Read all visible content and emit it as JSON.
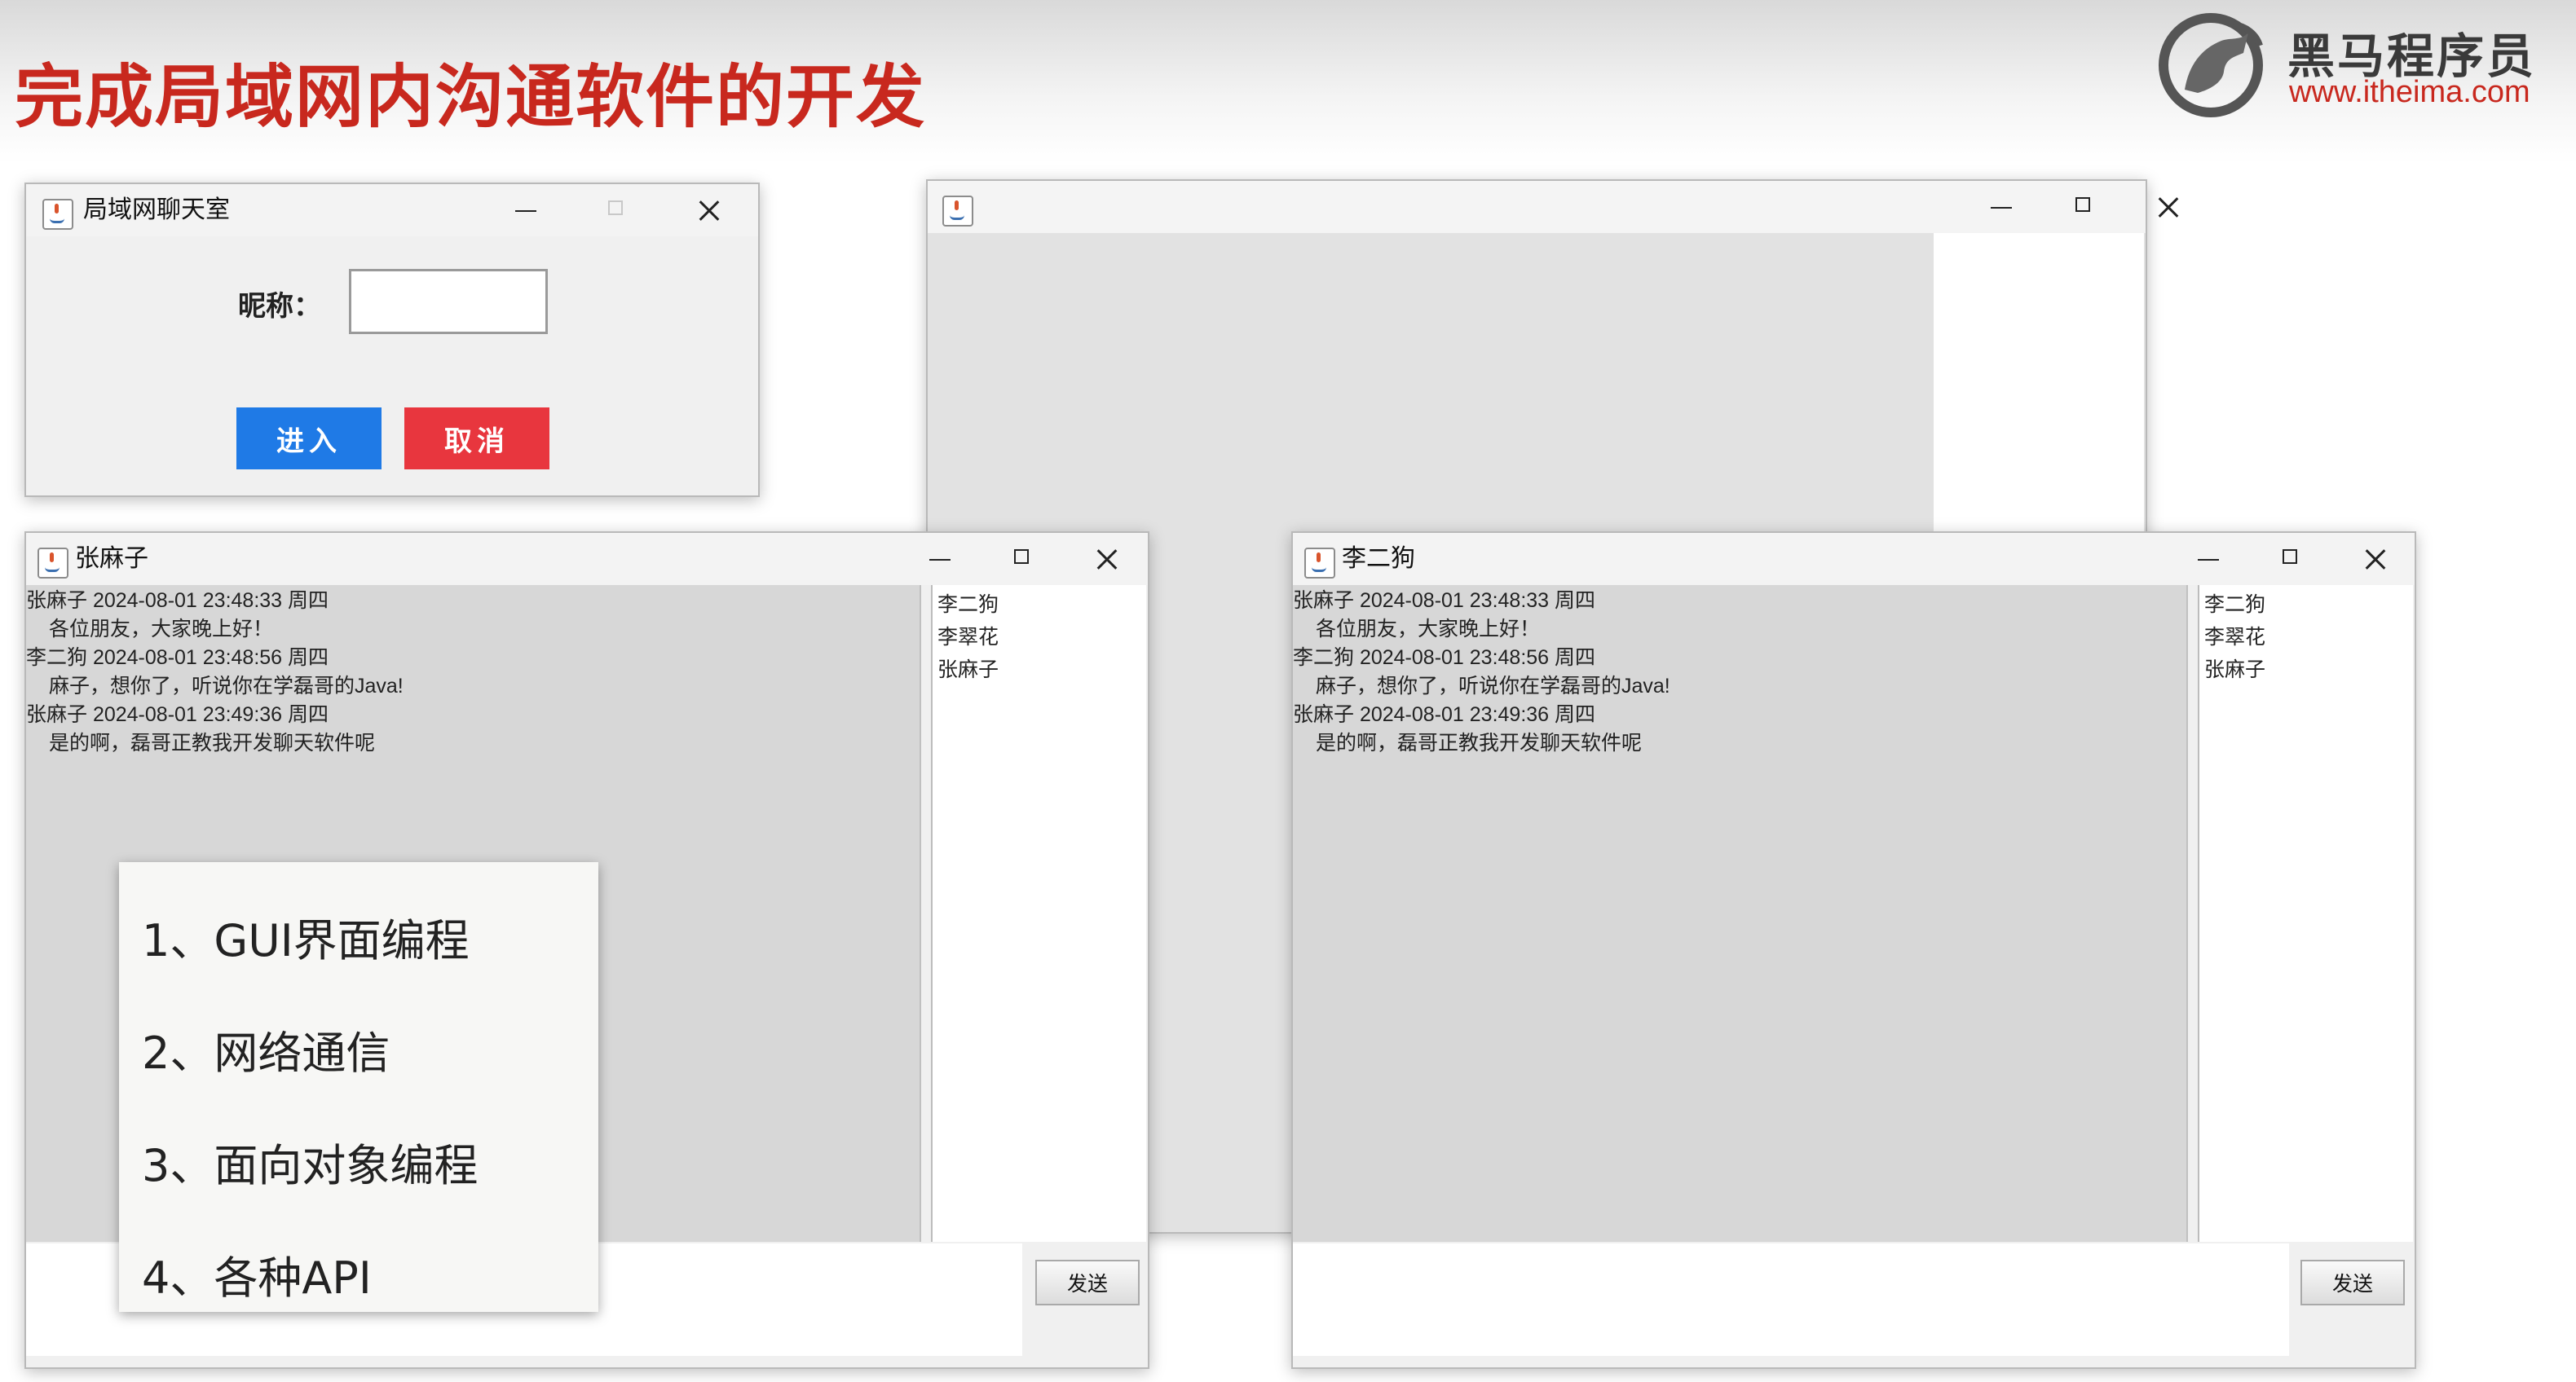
{
  "slide": {
    "title": "完成局域网内沟通软件的开发",
    "brand_name": "黑马程序员",
    "brand_url": "www.itheima.com"
  },
  "login_window": {
    "title": "局域网聊天室",
    "nickname_label": "昵称：",
    "nickname_value": "",
    "enter_label": "进入",
    "cancel_label": "取消"
  },
  "blank_window": {
    "title": ""
  },
  "chat_windows": [
    {
      "title": "张麻子",
      "messages": [
        {
          "header": "张麻子  2024-08-01 23:48:33 周四",
          "text": "各位朋友，大家晚上好！"
        },
        {
          "header": "李二狗  2024-08-01 23:48:56 周四",
          "text": "麻子，想你了，听说你在学磊哥的Java!"
        },
        {
          "header": "张麻子  2024-08-01 23:49:36 周四",
          "text": "是的啊，磊哥正教我开发聊天软件呢"
        }
      ],
      "users": [
        "李二狗",
        "李翠花",
        "张麻子"
      ],
      "send_label": "发送"
    },
    {
      "title": "李二狗",
      "messages": [
        {
          "header": "张麻子  2024-08-01 23:48:33 周四",
          "text": "各位朋友，大家晚上好！"
        },
        {
          "header": "李二狗  2024-08-01 23:48:56 周四",
          "text": "麻子，想你了，听说你在学磊哥的Java!"
        },
        {
          "header": "张麻子  2024-08-01 23:49:36 周四",
          "text": "是的啊，磊哥正教我开发聊天软件呢"
        }
      ],
      "users": [
        "李二狗",
        "李翠花",
        "张麻子"
      ],
      "send_label": "发送"
    }
  ],
  "topics": [
    "1、GUI界面编程",
    "2、网络通信",
    "3、面向对象编程",
    "4、各种API"
  ],
  "icons": {
    "window_icon": "java-icon",
    "minimize": "minimize-icon",
    "maximize": "maximize-icon",
    "close": "close-icon",
    "brand_logo": "horse-logo-icon"
  },
  "colors": {
    "title_red": "#c8281e",
    "enter_blue": "#1f7ae6",
    "cancel_red": "#e8363e"
  }
}
